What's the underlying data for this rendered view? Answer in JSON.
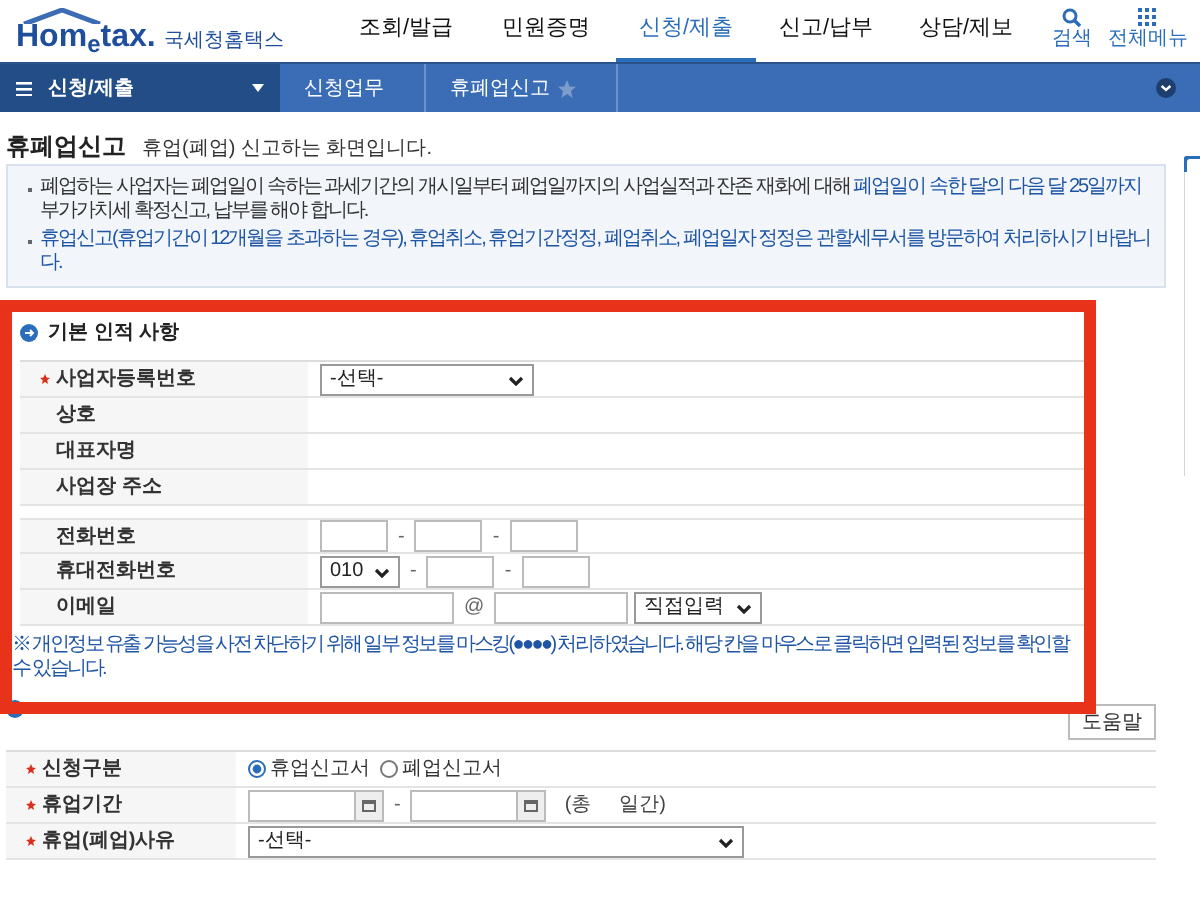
{
  "logo": {
    "brand": "Hom$_{e}$tax.",
    "org": "국세청홈택스"
  },
  "nav": [
    {
      "label": "조회/발급",
      "selected": false
    },
    {
      "label": "민원증명",
      "selected": false
    },
    {
      "label": "신청/제출",
      "selected": true
    },
    {
      "label": "신고/납부",
      "selected": false
    },
    {
      "label": "상담/제보",
      "selected": false
    }
  ],
  "tools": [
    {
      "label": "검색",
      "kind": "search"
    },
    {
      "label": "전체메뉴",
      "kind": "menu"
    }
  ],
  "breadcrumb": {
    "menu": "신청/제출",
    "items": [
      "신청업무",
      "휴폐업신고"
    ]
  },
  "page": {
    "title": "휴폐업신고",
    "subtitle": "휴업(폐업) 신고하는 화면입니다."
  },
  "notices": [
    {
      "text": "폐업하는 사업자는 폐업일이 속하는 과세기간의 개시일부터 폐업일까지의 사업실적과 잔존 재화에 대해 **폐업일이 속한 달의 다음 달 25일까지** 부가가치세 확정신고, 납부를 해야 합니다.",
      "highlight": false
    },
    {
      "text": "휴업신고(휴업기간이 12개월을 초과하는 경우), 휴업취소, 휴업기간정정, 폐업취소, 폐업일자 정정은 관할세무서를 방문하여 처리하시기 바랍니다.",
      "highlight": true
    }
  ],
  "basic_info": {
    "title": "기본 인적 사항",
    "rows": [
      {
        "kind": "select",
        "label": "사업자등록번호",
        "required": true,
        "value": "-선택-"
      },
      {
        "kind": "info",
        "label": "상호",
        "required": false
      },
      {
        "kind": "info",
        "label": "대표자명",
        "required": false
      },
      {
        "kind": "info",
        "label": "사업장 주소",
        "required": false
      },
      {
        "kind": "phone",
        "label": "전화번호",
        "required": false,
        "separator": "-"
      },
      {
        "kind": "mobile",
        "label": "휴대전화번호",
        "required": false,
        "prefix": "010",
        "separator": "-"
      },
      {
        "kind": "email",
        "label": "이메일",
        "required": false,
        "at": "@",
        "domain": "직접입력"
      }
    ],
    "notice": "※ 개인정보 유출 가능성을 사전 차단하기 위해 일부 정보를 마스킹(●●●●) 처리하였습니다. 해당 칸을 마우스로 클릭하면 입력된 정보를 확인할 수 있습니다."
  },
  "application": {
    "help": "도움말",
    "rows": [
      {
        "kind": "radio",
        "label": "신청구분",
        "required": true,
        "options": [
          {
            "label": "휴업신고서",
            "selected": true
          },
          {
            "label": "폐업신고서",
            "selected": false
          }
        ]
      },
      {
        "kind": "period",
        "label": "휴업기간",
        "required": true,
        "separator": "-",
        "total": "(총     일간)"
      },
      {
        "kind": "wide-select",
        "label": "휴업(폐업)사유",
        "required": true,
        "value": "-선택-"
      }
    ]
  }
}
